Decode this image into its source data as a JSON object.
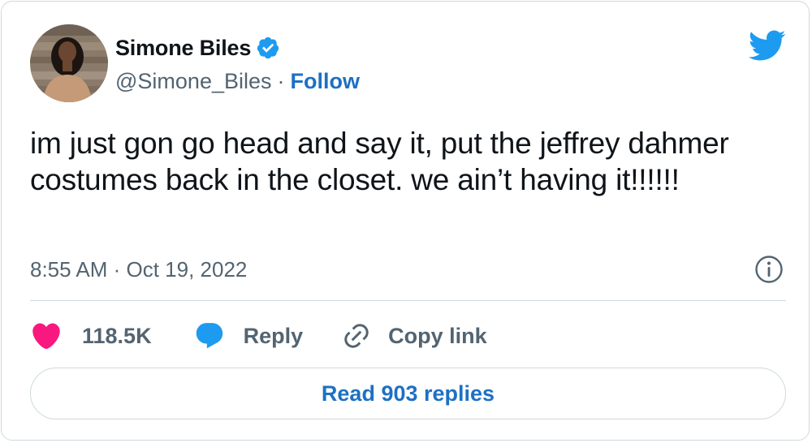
{
  "user": {
    "display_name": "Simone Biles",
    "handle": "@Simone_Biles",
    "separator": "·",
    "follow_label": "Follow",
    "verified": true
  },
  "tweet": {
    "text": "im just gon go head and say it, put the jeffrey dahmer costumes back in the closet. we ain’t having it!!!!!!",
    "timestamp": "8:55 AM · Oct 19, 2022"
  },
  "actions": {
    "like_count": "118.5K",
    "reply_label": "Reply",
    "copy_link_label": "Copy link"
  },
  "footer": {
    "read_replies_label": "Read 903 replies"
  },
  "icons": {
    "logo": "twitter-bird-icon",
    "verified": "verified-badge-icon",
    "info": "info-icon",
    "like": "heart-icon",
    "reply": "speech-bubble-icon",
    "copy": "link-icon"
  },
  "colors": {
    "brand_blue": "#1d9bf0",
    "link_blue": "#1d70c4",
    "like_pink": "#f91880",
    "text_primary": "#0f1419",
    "text_secondary": "#536471",
    "border": "#cfd9de"
  }
}
